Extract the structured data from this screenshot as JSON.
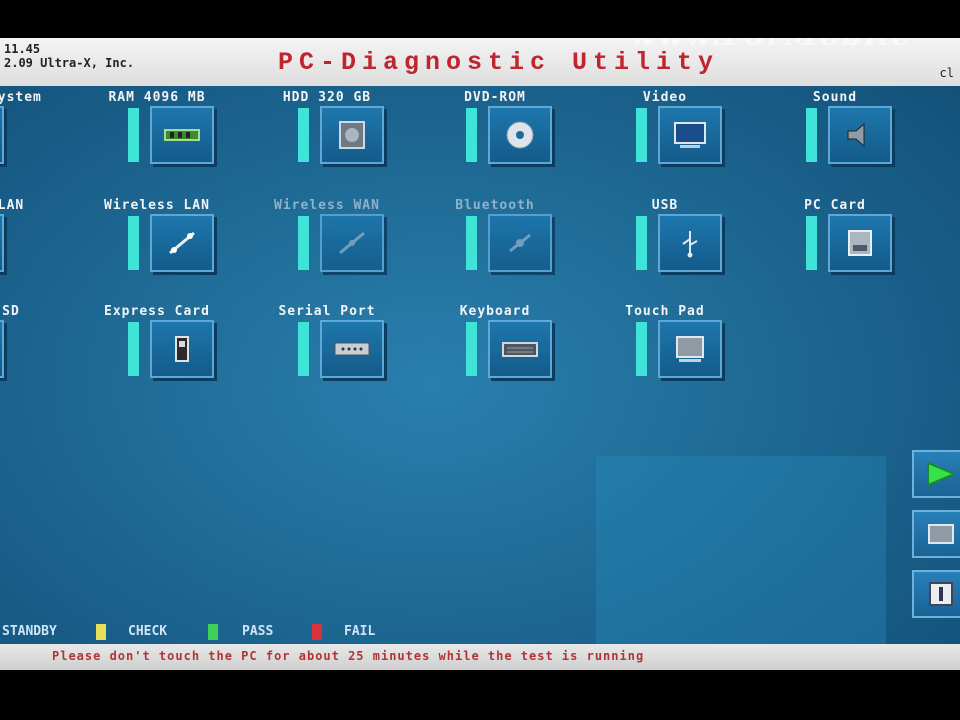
{
  "header": {
    "version_line1": "11.45",
    "version_line2": "2.09 Ultra-X, Inc.",
    "title": "PC-Diagnostic Utility",
    "clock": "cl",
    "watermark": "www.ForMobile"
  },
  "devices": [
    {
      "label": "/System",
      "icon": "motherboard-icon",
      "enabled": true
    },
    {
      "label": "RAM 4096 MB",
      "icon": "ram-icon",
      "enabled": true
    },
    {
      "label": "HDD 320 GB",
      "icon": "hdd-icon",
      "enabled": true
    },
    {
      "label": "DVD-ROM",
      "icon": "disc-icon",
      "enabled": true
    },
    {
      "label": "Video",
      "icon": "monitor-icon",
      "enabled": true
    },
    {
      "label": "Sound",
      "icon": "speaker-icon",
      "enabled": true
    },
    {
      "label": "LAN",
      "icon": "network-icon",
      "enabled": true
    },
    {
      "label": "Wireless LAN",
      "icon": "wireless-icon",
      "enabled": true
    },
    {
      "label": "Wireless WAN",
      "icon": "wireless-wan-icon",
      "enabled": false
    },
    {
      "label": "Bluetooth",
      "icon": "bluetooth-icon",
      "enabled": false
    },
    {
      "label": "USB",
      "icon": "usb-icon",
      "enabled": true
    },
    {
      "label": "PC Card",
      "icon": "pc-card-icon",
      "enabled": true
    },
    {
      "label": "SD",
      "icon": "sd-card-icon",
      "enabled": true
    },
    {
      "label": "Express Card",
      "icon": "express-card-icon",
      "enabled": true
    },
    {
      "label": "Serial Port",
      "icon": "serial-port-icon",
      "enabled": true
    },
    {
      "label": "Keyboard",
      "icon": "keyboard-icon",
      "enabled": true
    },
    {
      "label": "Touch Pad",
      "icon": "touchpad-icon",
      "enabled": true
    }
  ],
  "legend": {
    "standby": "STANDBY",
    "check": "CHECK",
    "pass": "PASS",
    "fail": "FAIL",
    "colors": {
      "standby": "#3fe3d8",
      "check": "#e8e05a",
      "pass": "#3ed15a",
      "fail": "#d8333c"
    }
  },
  "status_message": "Please don't touch the PC for about 25 minutes while the test is running",
  "side_buttons": [
    {
      "icon": "play-icon"
    },
    {
      "icon": "stop-icon"
    },
    {
      "icon": "info-icon"
    }
  ]
}
